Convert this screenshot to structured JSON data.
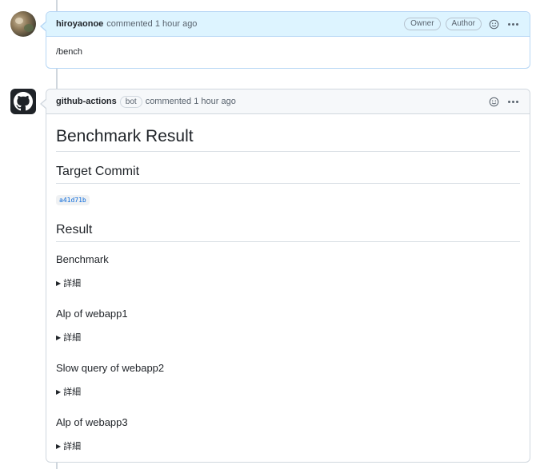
{
  "comments": [
    {
      "author": "hiroyaonoe",
      "action": "commented 1 hour ago",
      "badges": [
        "Owner",
        "Author"
      ],
      "body": "/bench"
    },
    {
      "author": "github-actions",
      "bot_label": "bot",
      "action": "commented 1 hour ago",
      "title": "Benchmark Result",
      "target_heading": "Target Commit",
      "commit": "a41d71b",
      "result_heading": "Result",
      "sections": [
        {
          "title": "Benchmark",
          "details": "詳細"
        },
        {
          "title": "Alp of webapp1",
          "details": "詳細"
        },
        {
          "title": "Slow query of webapp2",
          "details": "詳細"
        },
        {
          "title": "Alp of webapp3",
          "details": "詳細"
        }
      ]
    }
  ],
  "icons": {
    "emoji_reaction": "smiley-icon",
    "more_options": "kebab-horizontal-icon",
    "bot_avatar": "github-mark-icon"
  },
  "colors": {
    "owner_header_bg": "#ddf4ff",
    "owner_border": "#b6d6f5",
    "link": "#0969da"
  }
}
